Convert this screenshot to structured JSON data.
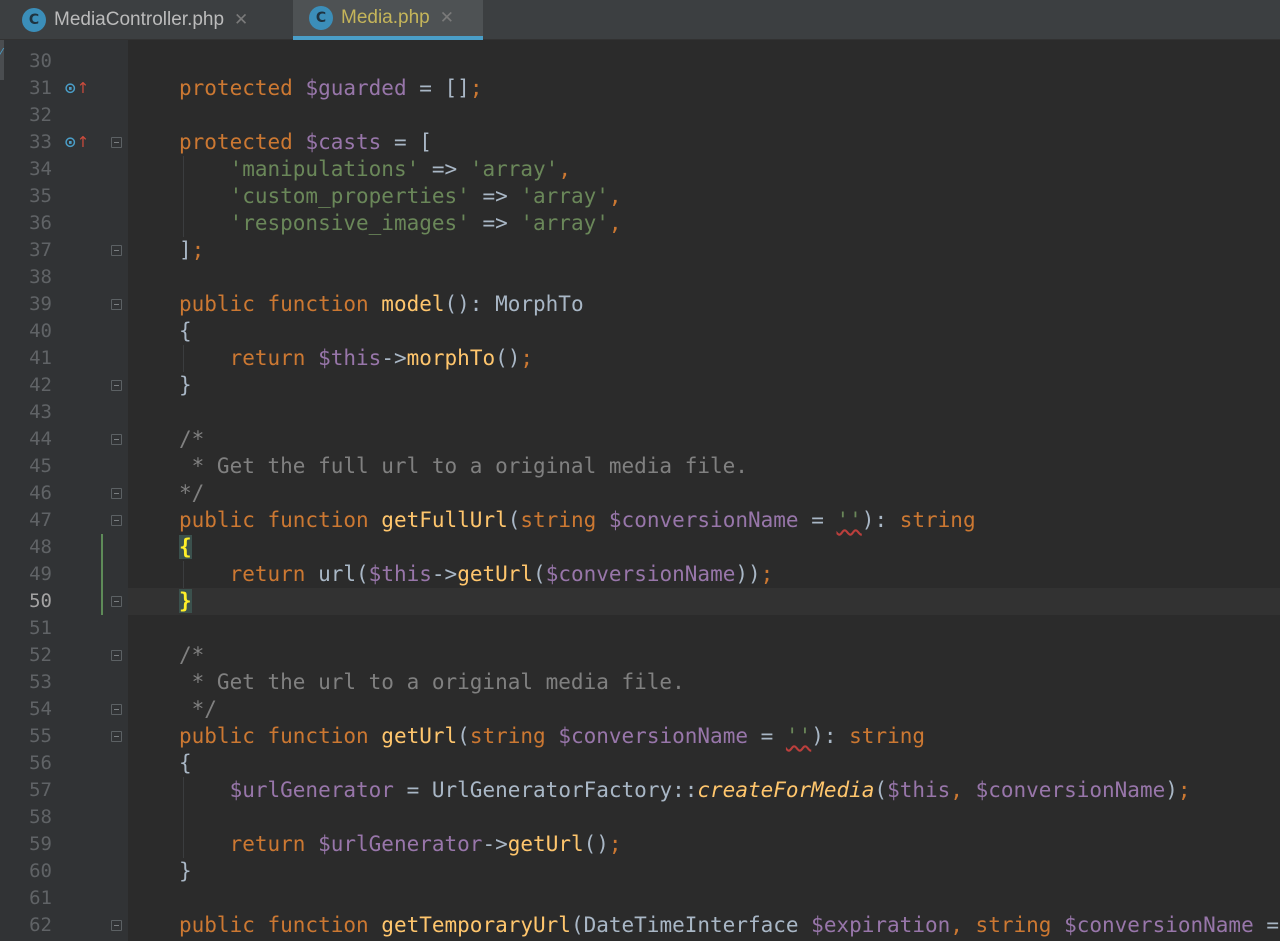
{
  "tabs": [
    {
      "label": "MediaController.php",
      "icon": "C",
      "active": false
    },
    {
      "label": "Media.php",
      "icon": "C",
      "active": true
    }
  ],
  "editor": {
    "current_line": 50,
    "lines": [
      {
        "n": "30",
        "tokens": []
      },
      {
        "n": "31",
        "tokens": [
          [
            "k",
            "protected "
          ],
          [
            "v",
            "$guarded"
          ],
          [
            "t",
            " = []"
          ],
          [
            "k",
            ";"
          ]
        ]
      },
      {
        "n": "32",
        "tokens": []
      },
      {
        "n": "33",
        "tokens": [
          [
            "k",
            "protected "
          ],
          [
            "v",
            "$casts"
          ],
          [
            "t",
            " = ["
          ]
        ]
      },
      {
        "n": "34",
        "tokens": [
          [
            "t",
            "    "
          ],
          [
            "s",
            "'manipulations'"
          ],
          [
            "t",
            " => "
          ],
          [
            "s",
            "'array'"
          ],
          [
            "k",
            ","
          ]
        ]
      },
      {
        "n": "35",
        "tokens": [
          [
            "t",
            "    "
          ],
          [
            "s",
            "'custom_properties'"
          ],
          [
            "t",
            " => "
          ],
          [
            "s",
            "'array'"
          ],
          [
            "k",
            ","
          ]
        ]
      },
      {
        "n": "36",
        "tokens": [
          [
            "t",
            "    "
          ],
          [
            "s",
            "'responsive_images'"
          ],
          [
            "t",
            " => "
          ],
          [
            "s",
            "'array'"
          ],
          [
            "k",
            ","
          ]
        ]
      },
      {
        "n": "37",
        "tokens": [
          [
            "t",
            "]"
          ],
          [
            "k",
            ";"
          ]
        ]
      },
      {
        "n": "38",
        "tokens": []
      },
      {
        "n": "39",
        "tokens": [
          [
            "k",
            "public function "
          ],
          [
            "f",
            "model"
          ],
          [
            "t",
            "(): MorphTo"
          ]
        ]
      },
      {
        "n": "40",
        "tokens": [
          [
            "t",
            "{"
          ]
        ]
      },
      {
        "n": "41",
        "tokens": [
          [
            "t",
            "    "
          ],
          [
            "k",
            "return "
          ],
          [
            "v",
            "$this"
          ],
          [
            "t",
            "->"
          ],
          [
            "f",
            "morphTo"
          ],
          [
            "t",
            "()"
          ],
          [
            "k",
            ";"
          ]
        ]
      },
      {
        "n": "42",
        "tokens": [
          [
            "t",
            "}"
          ]
        ]
      },
      {
        "n": "43",
        "tokens": []
      },
      {
        "n": "44",
        "tokens": [
          [
            "c",
            "/*"
          ]
        ]
      },
      {
        "n": "45",
        "tokens": [
          [
            "c",
            " * Get the full url to a original media file."
          ]
        ]
      },
      {
        "n": "46",
        "tokens": [
          [
            "c",
            "*/"
          ]
        ]
      },
      {
        "n": "47",
        "tokens": [
          [
            "k",
            "public function "
          ],
          [
            "f",
            "getFullUrl"
          ],
          [
            "t",
            "("
          ],
          [
            "k",
            "string "
          ],
          [
            "v",
            "$conversionName"
          ],
          [
            "t",
            " = "
          ],
          [
            "sw",
            "''"
          ],
          [
            "t",
            "): "
          ],
          [
            "k",
            "string"
          ]
        ]
      },
      {
        "n": "48",
        "tokens": [
          [
            "b",
            "{"
          ]
        ]
      },
      {
        "n": "49",
        "tokens": [
          [
            "t",
            "    "
          ],
          [
            "k",
            "return "
          ],
          [
            "t",
            "url("
          ],
          [
            "v",
            "$this"
          ],
          [
            "t",
            "->"
          ],
          [
            "f",
            "getUrl"
          ],
          [
            "t",
            "("
          ],
          [
            "v",
            "$conversionName"
          ],
          [
            "t",
            "))"
          ],
          [
            "k",
            ";"
          ]
        ]
      },
      {
        "n": "50",
        "tokens": [
          [
            "b",
            "}"
          ]
        ]
      },
      {
        "n": "51",
        "tokens": []
      },
      {
        "n": "52",
        "tokens": [
          [
            "c",
            "/*"
          ]
        ]
      },
      {
        "n": "53",
        "tokens": [
          [
            "c",
            " * Get the url to a original media file."
          ]
        ]
      },
      {
        "n": "54",
        "tokens": [
          [
            "c",
            " */"
          ]
        ]
      },
      {
        "n": "55",
        "tokens": [
          [
            "k",
            "public function "
          ],
          [
            "f",
            "getUrl"
          ],
          [
            "t",
            "("
          ],
          [
            "k",
            "string "
          ],
          [
            "v",
            "$conversionName"
          ],
          [
            "t",
            " = "
          ],
          [
            "sw",
            "''"
          ],
          [
            "t",
            "): "
          ],
          [
            "k",
            "string"
          ]
        ]
      },
      {
        "n": "56",
        "tokens": [
          [
            "t",
            "{"
          ]
        ]
      },
      {
        "n": "57",
        "tokens": [
          [
            "t",
            "    "
          ],
          [
            "v",
            "$urlGenerator"
          ],
          [
            "t",
            " = UrlGeneratorFactory::"
          ],
          [
            "i",
            "createForMedia"
          ],
          [
            "t",
            "("
          ],
          [
            "v",
            "$this"
          ],
          [
            "k",
            ", "
          ],
          [
            "v",
            "$conversionName"
          ],
          [
            "t",
            ")"
          ],
          [
            "k",
            ";"
          ]
        ]
      },
      {
        "n": "58",
        "tokens": []
      },
      {
        "n": "59",
        "tokens": [
          [
            "t",
            "    "
          ],
          [
            "k",
            "return "
          ],
          [
            "v",
            "$urlGenerator"
          ],
          [
            "t",
            "->"
          ],
          [
            "f",
            "getUrl"
          ],
          [
            "t",
            "()"
          ],
          [
            "k",
            ";"
          ]
        ]
      },
      {
        "n": "60",
        "tokens": [
          [
            "t",
            "}"
          ]
        ]
      },
      {
        "n": "61",
        "tokens": []
      },
      {
        "n": "62",
        "tokens": [
          [
            "k",
            "public function "
          ],
          [
            "f",
            "getTemporaryUrl"
          ],
          [
            "t",
            "(DateTimeInterface "
          ],
          [
            "v",
            "$expiration"
          ],
          [
            "k",
            ", "
          ],
          [
            "k",
            "string "
          ],
          [
            "v",
            "$conversionName"
          ],
          [
            "t",
            " ="
          ]
        ]
      }
    ]
  },
  "colors": {
    "keyword": "#cc7832",
    "variable": "#9876aa",
    "string": "#6a8759",
    "function": "#ffc66d",
    "comment": "#808080",
    "text": "#a9b7c6",
    "background": "#2b2b2b",
    "tab_accent": "#4a9ec8"
  },
  "icons": {
    "tab_icon": "php-class-icon",
    "tab_close": "close-icon",
    "override": "override-method-icon",
    "fold": "fold-marker-icon"
  }
}
